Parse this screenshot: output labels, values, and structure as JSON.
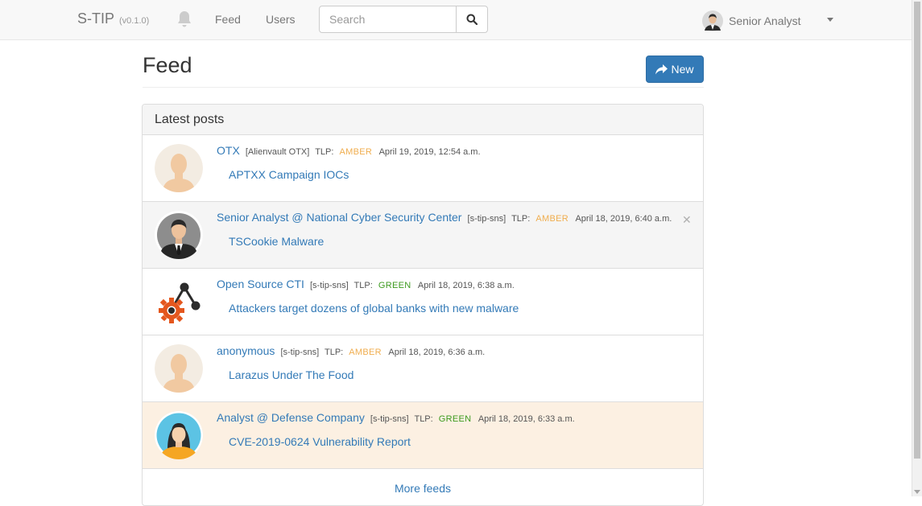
{
  "navbar": {
    "brand": "S-TIP",
    "version": "(v0.1.0)",
    "links": [
      "Feed",
      "Users"
    ],
    "search_placeholder": "Search",
    "user_name": "Senior Analyst"
  },
  "header": {
    "title": "Feed",
    "new_button": "New"
  },
  "panel": {
    "heading": "Latest posts",
    "more": "More feeds"
  },
  "posts": [
    {
      "user": "OTX",
      "source": "[Alienvault OTX]",
      "tlp_label": "TLP:",
      "tlp": "AMBER",
      "date": "April 19, 2019, 12:54 a.m.",
      "title": "APTXX Campaign IOCs",
      "avatar": "default-avatar-icon"
    },
    {
      "user": "Senior Analyst @ National Cyber Security Center",
      "source": "[s-tip-sns]",
      "tlp_label": "TLP:",
      "tlp": "AMBER",
      "date": "April 18, 2019, 6:40 a.m.",
      "title": "TSCookie Malware",
      "avatar": "businessman-avatar-icon"
    },
    {
      "user": "Open Source CTI",
      "source": "[s-tip-sns]",
      "tlp_label": "TLP:",
      "tlp": "GREEN",
      "date": "April 18, 2019, 6:38 a.m.",
      "title": "Attackers target dozens of global banks with new malware",
      "avatar": "share-gear-logo-icon"
    },
    {
      "user": "anonymous",
      "source": "[s-tip-sns]",
      "tlp_label": "TLP:",
      "tlp": "AMBER",
      "date": "April 18, 2019, 6:36 a.m.",
      "title": "Larazus Under The Food",
      "avatar": "default-avatar-icon"
    },
    {
      "user": "Analyst @ Defense Company",
      "source": "[s-tip-sns]",
      "tlp_label": "TLP:",
      "tlp": "GREEN",
      "date": "April 18, 2019, 6:33 a.m.",
      "title": "CVE-2019-0624 Vulnerability Report",
      "avatar": "woman-avatar-icon"
    }
  ],
  "colors": {
    "amber": "#f0ad4e",
    "green": "#3c9a1e",
    "link": "#337ab7",
    "primary": "#337ab7",
    "warning_row": "#fcf0e2"
  }
}
